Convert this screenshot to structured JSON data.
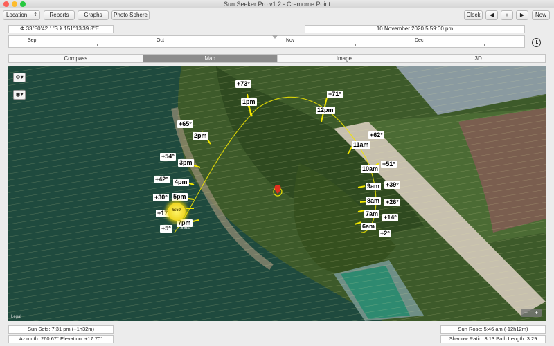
{
  "window": {
    "title": "Sun Seeker Pro v1.2 - Cremorne Point"
  },
  "toolbar": {
    "location_label": "Location",
    "reports_label": "Reports",
    "graphs_label": "Graphs",
    "photosphere_label": "Photo Sphere",
    "clock_label": "Clock",
    "now_label": "Now"
  },
  "coords": {
    "text": "Φ 33°50'42.1\"S   λ 151°13'39.8\"E"
  },
  "datetime": {
    "text": "10 November 2020   5:59:00 pm"
  },
  "timeline": {
    "months": [
      "Sep",
      "Oct",
      "Nov",
      "Dec"
    ]
  },
  "view_tabs": [
    "Compass",
    "Map",
    "Image",
    "3D"
  ],
  "active_tab": "Map",
  "map": {
    "legal": "Legal",
    "sun_disc_label": "5:59",
    "sun_hour_labels": [
      {
        "text": "1pm"
      },
      {
        "text": "12pm"
      },
      {
        "text": "2pm"
      },
      {
        "text": "11am"
      },
      {
        "text": "3pm"
      },
      {
        "text": "10am"
      },
      {
        "text": "4pm"
      },
      {
        "text": "9am"
      },
      {
        "text": "5pm"
      },
      {
        "text": "8am"
      },
      {
        "text": "7pm"
      },
      {
        "text": "7am"
      },
      {
        "text": "6am"
      }
    ],
    "elevation_labels": [
      {
        "text": "+73°"
      },
      {
        "text": "+71°"
      },
      {
        "text": "+65°"
      },
      {
        "text": "+62°"
      },
      {
        "text": "+54°"
      },
      {
        "text": "+51°"
      },
      {
        "text": "+42°"
      },
      {
        "text": "+39°"
      },
      {
        "text": "+30°"
      },
      {
        "text": "+26°"
      },
      {
        "text": "+17°"
      },
      {
        "text": "+14°"
      },
      {
        "text": "+5°"
      },
      {
        "text": "+2°"
      }
    ],
    "sets_label": "Sets",
    "zoom_minus": "−",
    "zoom_plus": "+"
  },
  "info": {
    "sun_sets": "Sun Sets: 7:31 pm (+1h32m)",
    "azimuth": "Azimuth: 260.67°  Elevation: +17.70°",
    "sun_rose": "Sun Rose: 5:46 am (-12h12m)",
    "shadow": "Shadow Ratio: 3.13  Path Length: 3.29"
  },
  "colors": {
    "accent_path": "#f2e600",
    "map_water": "#1f4a3e",
    "pin": "#e0301e"
  }
}
